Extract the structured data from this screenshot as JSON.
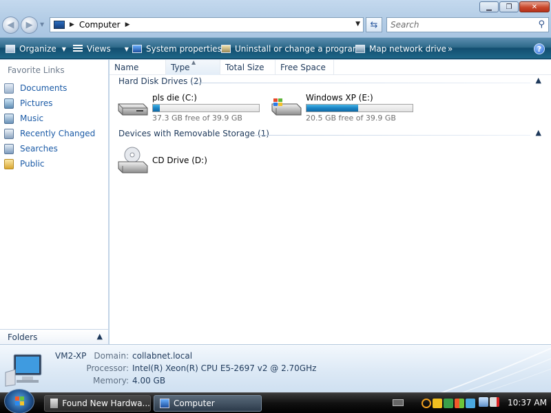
{
  "window": {
    "title_controls": {
      "minimize": "▁",
      "maximize": "❐",
      "close": "✕"
    }
  },
  "address_bar": {
    "crumbs": [
      "Computer"
    ],
    "search_placeholder": "Search"
  },
  "toolbar": {
    "items": [
      {
        "label": "Organize",
        "icon": "organize-icon",
        "has_dropdown": true
      },
      {
        "label": "Views",
        "icon": "views-icon",
        "has_dropdown": true
      },
      {
        "label": "System properties",
        "icon": "system-properties-icon"
      },
      {
        "label": "Uninstall or change a program",
        "icon": "uninstall-icon"
      },
      {
        "label": "Map network drive",
        "icon": "map-drive-icon"
      }
    ],
    "more_label": "»",
    "help_label": "?"
  },
  "navigation": {
    "favorites_header": "Favorite Links",
    "favorites": [
      {
        "label": "Documents",
        "icon": "documents-icon"
      },
      {
        "label": "Pictures",
        "icon": "pictures-icon"
      },
      {
        "label": "Music",
        "icon": "music-icon"
      },
      {
        "label": "Recently Changed",
        "icon": "recently-changed-icon"
      },
      {
        "label": "Searches",
        "icon": "searches-icon"
      },
      {
        "label": "Public",
        "icon": "public-folder-icon"
      }
    ],
    "folders_label": "Folders"
  },
  "columns": [
    "Name",
    "Type",
    "Total Size",
    "Free Space"
  ],
  "groups": [
    {
      "title": "Hard Disk Drives (2)",
      "items": [
        {
          "name": "pls die (C:)",
          "free_text": "37.3 GB free of 39.9 GB",
          "used_fraction": 0.065
        },
        {
          "name": "Windows XP (E:)",
          "free_text": "20.5 GB free of 39.9 GB",
          "used_fraction": 0.486
        }
      ]
    },
    {
      "title": "Devices with Removable Storage (1)",
      "items": [
        {
          "name": "CD Drive (D:)"
        }
      ]
    }
  ],
  "details": {
    "computer_name": "VM2-XP",
    "domain_label": "Domain:",
    "domain": "collabnet.local",
    "processor_label": "Processor:",
    "processor": "Intel(R) Xeon(R) CPU E5-2697 v2 @ 2.70GHz",
    "memory_label": "Memory:",
    "memory": "4.00 GB"
  },
  "taskbar": {
    "tasks": [
      {
        "label": "Found New Hardwa...",
        "active": false
      },
      {
        "label": "Computer",
        "active": true
      }
    ],
    "clock": "10:37 AM"
  },
  "colors": {
    "accent_link": "#1a5aa6",
    "toolbar_bg": "#1e6788",
    "progress_fill": "#1b84c4",
    "close_button": "#c9482c"
  }
}
